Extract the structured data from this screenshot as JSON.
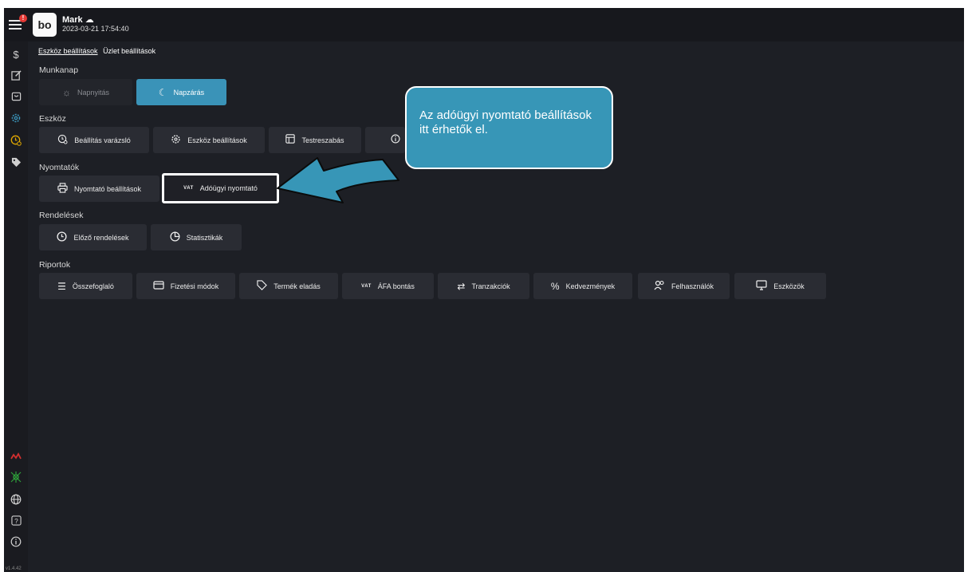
{
  "header": {
    "user_name": "Mark ☁",
    "timestamp": "2023-03-21 17:54:40",
    "logo_text": "bo",
    "notification_badge": "!"
  },
  "sidebar": {
    "icons": [
      "dollar-icon",
      "edit-icon",
      "bag-icon",
      "settings-icon",
      "clock-warning-icon",
      "tag-icon",
      "status-red-icon",
      "status-green-icon",
      "globe-icon",
      "help-icon",
      "info-icon"
    ],
    "version": "v1.4.42"
  },
  "tabs": {
    "device_settings": "Eszköz beállítások",
    "store_settings": "Üzlet beállítások"
  },
  "sections": {
    "workday": {
      "title": "Munkanap",
      "open_label": "Napnyitás",
      "close_label": "Napzárás"
    },
    "device": {
      "title": "Eszköz",
      "wizard": "Beállítás varázsló",
      "device_settings": "Eszköz beállítások",
      "customize": "Testreszabás"
    },
    "printers": {
      "title": "Nyomtatók",
      "printer_settings": "Nyomtató beállítások",
      "fiscal_printer": "Adóügyi nyomtató",
      "vat_badge": "VAT"
    },
    "orders": {
      "title": "Rendelések",
      "previous_orders": "Előző rendelések",
      "statistics": "Statisztikák"
    },
    "reports": {
      "title": "Riportok",
      "items": {
        "summary": "Összefoglaló",
        "payment_methods": "Fizetési módok",
        "product_sales": "Termék eladás",
        "vat_breakdown": "ÁFA bontás",
        "transactions": "Tranzakciók",
        "discounts": "Kedvezmények",
        "users": "Felhasználók",
        "devices": "Eszközök"
      },
      "vat_badge": "VAT"
    }
  },
  "callout": {
    "text": "Az adóügyi nyomtató beállítások itt érhetők el."
  },
  "colors": {
    "accent": "#3a93b8",
    "callout": "#3796b7",
    "background": "#1d1f25",
    "button": "#2a2c33"
  }
}
